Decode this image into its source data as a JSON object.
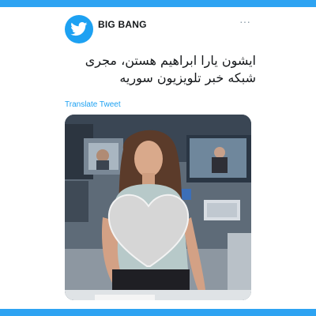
{
  "tweet": {
    "username": "BIG BANG",
    "more_glyph": "···",
    "text": "ایشون یارا ابراهیم هستن، مجری شبکه خبر تلویزیون سوریه",
    "translate_label": "Translate Tweet"
  },
  "icons": {
    "avatar": "twitter-bird-icon",
    "more": "more-options-icon",
    "overlay": "heart-icon"
  },
  "colors": {
    "frame": "#2ea3f2",
    "twitter_blue": "#1da1f2",
    "text": "#14171a",
    "muted": "#8899a6"
  }
}
